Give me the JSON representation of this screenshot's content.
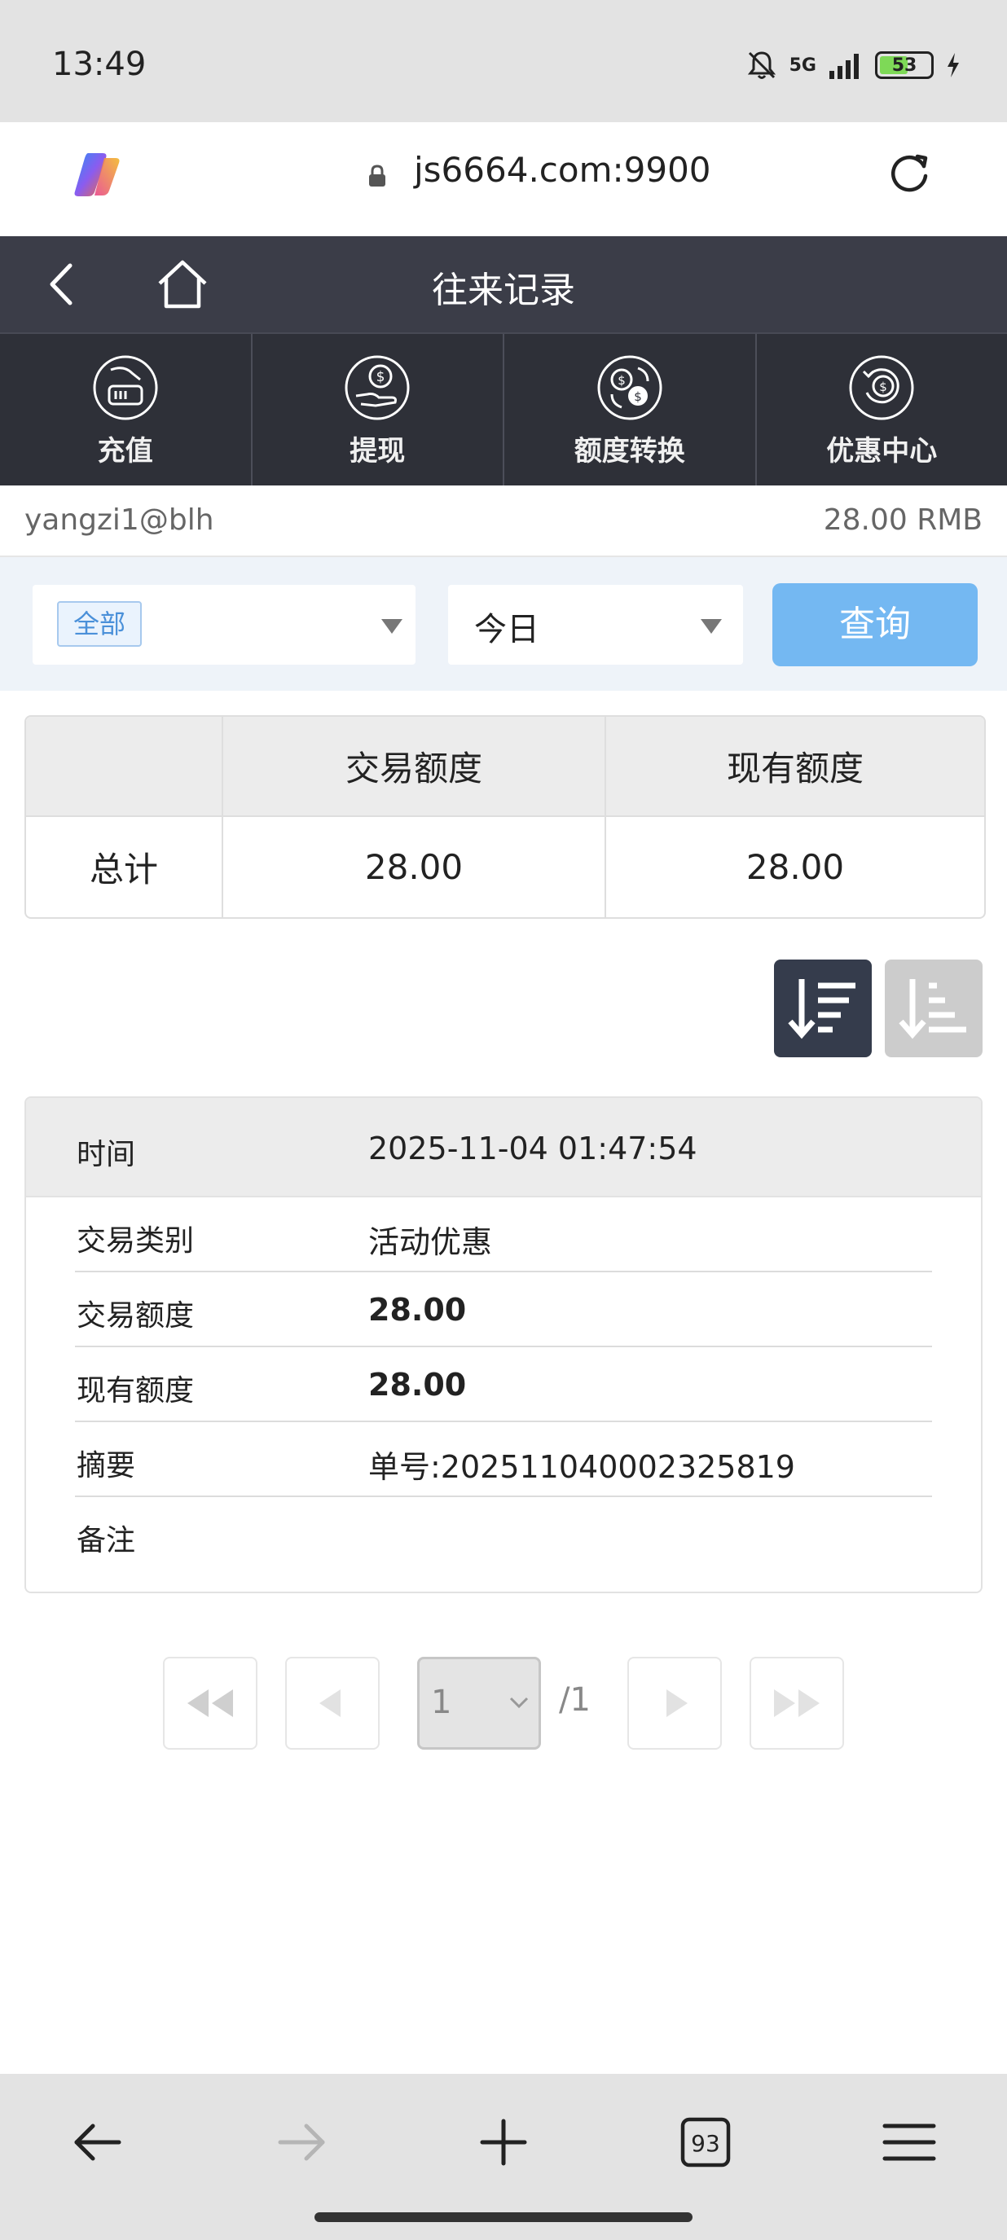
{
  "status_bar": {
    "time": "13:49",
    "network": "5G",
    "battery": "53"
  },
  "browser": {
    "url": "js6664.com:9900",
    "tab_count": "93"
  },
  "header": {
    "title": "往来记录"
  },
  "nav": [
    {
      "label": "充值",
      "icon": "deposit-icon"
    },
    {
      "label": "提现",
      "icon": "withdraw-icon"
    },
    {
      "label": "额度转换",
      "icon": "transfer-icon"
    },
    {
      "label": "优惠中心",
      "icon": "promo-icon"
    }
  ],
  "account": {
    "username": "yangzi1@blh",
    "balance": "28.00 RMB"
  },
  "filter": {
    "type": "全部",
    "period": "今日",
    "query_label": "查询"
  },
  "summary": {
    "headers": [
      "",
      "交易额度",
      "现有额度"
    ],
    "total_label": "总计",
    "total_amount": "28.00",
    "total_balance": "28.00"
  },
  "record": {
    "time_label": "时间",
    "time_value": "2025-11-04 01:47:54",
    "type_label": "交易类别",
    "type_value": "活动优惠",
    "amount_label": "交易额度",
    "amount_value": "28.00",
    "balance_label": "现有额度",
    "balance_value": "28.00",
    "summary_label": "摘要",
    "summary_value": "单号:202511040002325819",
    "note_label": "备注",
    "note_value": ""
  },
  "pagination": {
    "current": "1",
    "total": "/1"
  }
}
